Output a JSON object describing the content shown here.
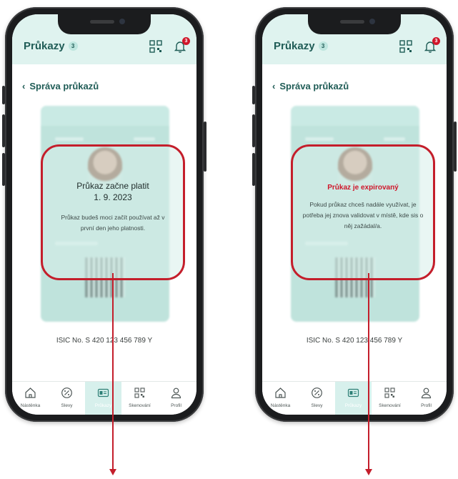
{
  "phones": [
    {
      "header": {
        "title": "Průkazy",
        "count": "3",
        "notifications": "3"
      },
      "back_label": "Správa průkazů",
      "overlay": {
        "title": "Průkaz začne platit",
        "date": "1. 9. 2023",
        "body": "Průkaz budeš moci začít používat až v první den jeho platnosti."
      },
      "isic_number": "ISIC No.  S 420 123 456 789 Y",
      "tabs": [
        {
          "label": "Nástěnka",
          "icon": "home-icon"
        },
        {
          "label": "Slevy",
          "icon": "discount-icon"
        },
        {
          "label": "Průkazy",
          "icon": "card-icon"
        },
        {
          "label": "Skenování",
          "icon": "scan-icon"
        },
        {
          "label": "Profil",
          "icon": "profile-icon"
        }
      ]
    },
    {
      "header": {
        "title": "Průkazy",
        "count": "3",
        "notifications": "3"
      },
      "back_label": "Správa průkazů",
      "overlay": {
        "title": "Průkaz je expirovaný",
        "body": "Pokud průkaz chceš nadále využívat, je potřeba jej znova validovat v místě, kde sis o něj zažádal/a."
      },
      "isic_number": "ISIC No.  S 420 123 456 789 Y",
      "tabs": [
        {
          "label": "Nástěnka",
          "icon": "home-icon"
        },
        {
          "label": "Slevy",
          "icon": "discount-icon"
        },
        {
          "label": "Průkazy",
          "icon": "card-icon"
        },
        {
          "label": "Skenování",
          "icon": "scan-icon"
        },
        {
          "label": "Profil",
          "icon": "profile-icon"
        }
      ]
    }
  ],
  "colors": {
    "accent": "#1f5c56",
    "header_bg": "#dff3ef",
    "highlight": "#c41e2b",
    "active_tab": "#d7f0ec"
  }
}
